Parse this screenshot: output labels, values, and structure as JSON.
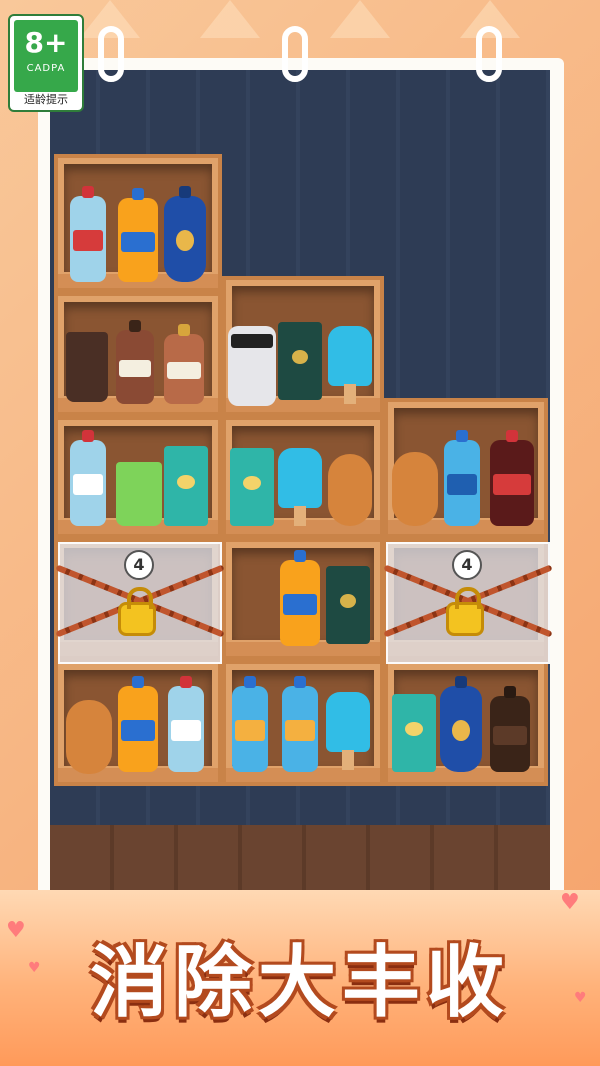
{
  "age_badge": {
    "age": "8+",
    "org": "CADPA",
    "tip": "适龄提示"
  },
  "locked_boxes": [
    {
      "count": "4"
    },
    {
      "count": "4"
    }
  ],
  "banner": {
    "title": "消除大丰收"
  },
  "colors": {
    "shelf_wood": "#e0a26a",
    "wall": "#2e3c55",
    "banner_text_outline": "#b34a1e"
  },
  "icons": [
    "water-bottle-icon",
    "orange-soda-icon",
    "blue-liqueur-icon",
    "coffee-cup-icon",
    "syrup-bottle-icon",
    "panda-jar-icon",
    "tea-box-icon",
    "popsicle-icon",
    "bread-icon",
    "juice-glass-icon",
    "cola-bottle-icon",
    "padlock-icon"
  ]
}
